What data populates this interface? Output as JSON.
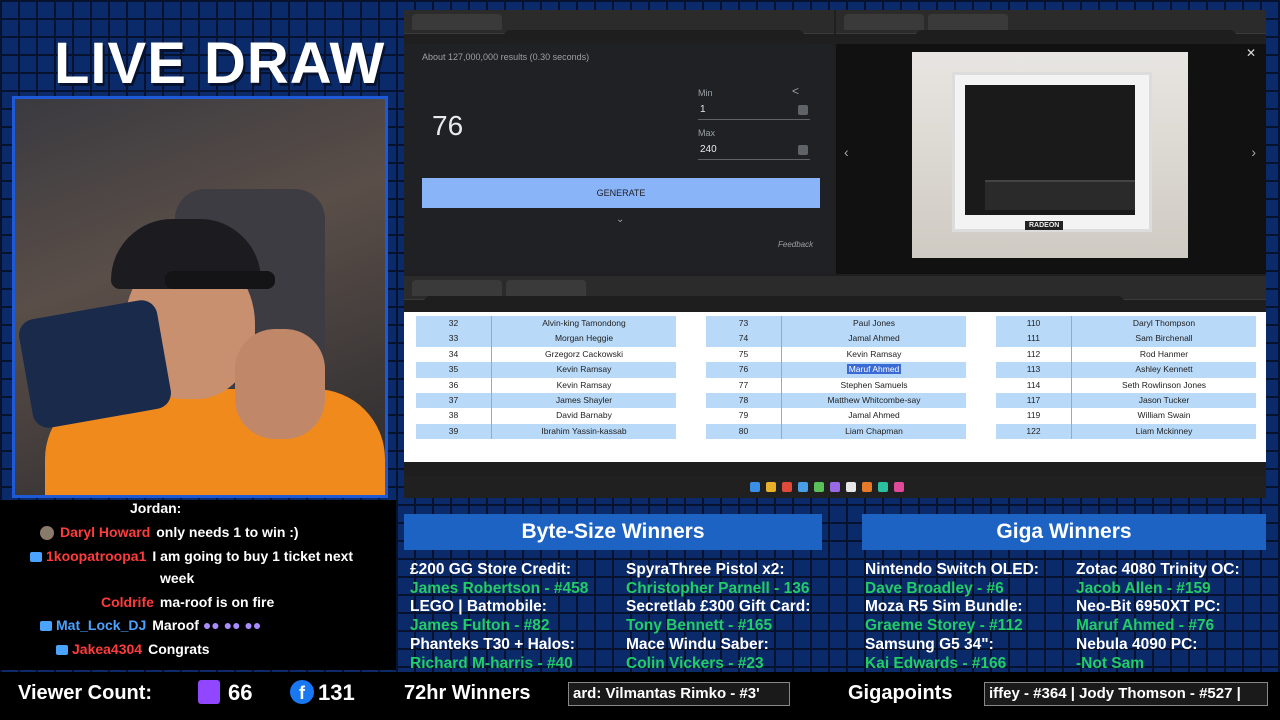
{
  "overlay": {
    "title": "LIVE DRAW"
  },
  "rng": {
    "results_text": "About 127,000,000 results (0.30 seconds)",
    "number": "76",
    "min_label": "Min",
    "min_value": "1",
    "max_label": "Max",
    "max_value": "240",
    "generate_label": "GENERATE",
    "feedback_label": "Feedback"
  },
  "viewer": {
    "gpu_brand": "RADEON"
  },
  "entries": {
    "col1": [
      {
        "n": "32",
        "name": "Alvin-king Tamondong"
      },
      {
        "n": "33",
        "name": "Morgan Heggie"
      },
      {
        "n": "34",
        "name": "Grzegorz Cackowski"
      },
      {
        "n": "35",
        "name": "Kevin Ramsay"
      },
      {
        "n": "36",
        "name": "Kevin Ramsay"
      },
      {
        "n": "37",
        "name": "James Shayler"
      },
      {
        "n": "38",
        "name": "David Barnaby"
      },
      {
        "n": "39",
        "name": "Ibrahim Yassin-kassab"
      }
    ],
    "col2": [
      {
        "n": "73",
        "name": "Paul Jones"
      },
      {
        "n": "74",
        "name": "Jamal Ahmed"
      },
      {
        "n": "75",
        "name": "Kevin Ramsay"
      },
      {
        "n": "76",
        "name": "Maruf Ahmed"
      },
      {
        "n": "77",
        "name": "Stephen Samuels"
      },
      {
        "n": "78",
        "name": "Matthew Whitcombe-say"
      },
      {
        "n": "79",
        "name": "Jamal Ahmed"
      },
      {
        "n": "80",
        "name": "Liam Chapman"
      }
    ],
    "col3": [
      {
        "n": "110",
        "name": "Daryl Thompson"
      },
      {
        "n": "111",
        "name": "Sam Birchenall"
      },
      {
        "n": "112",
        "name": "Rod Hanmer"
      },
      {
        "n": "113",
        "name": "Ashley Kennett"
      },
      {
        "n": "114",
        "name": "Seth Rowlinson Jones"
      },
      {
        "n": "117",
        "name": "Jason Tucker"
      },
      {
        "n": "119",
        "name": "William Swain"
      },
      {
        "n": "122",
        "name": "Liam Mckinney"
      }
    ]
  },
  "chat": {
    "partial": "Jordan:",
    "messages": [
      {
        "user": "Daryl Howard",
        "color": "#ff3b3b",
        "text": "only needs 1 to win :)"
      },
      {
        "user": "1koopatroopa1",
        "color": "#ff3b3b",
        "text": "I am going to buy 1 ticket next",
        "text2": "week"
      },
      {
        "user": "Coldrife",
        "color": "#ff3b3b",
        "text": "ma-roof is on fire"
      },
      {
        "user": "Mat_Lock_DJ",
        "color": "#4aa3ff",
        "text": "Maroof"
      },
      {
        "user": "Jakea4304",
        "color": "#ff3b3b",
        "text": "Congrats"
      }
    ]
  },
  "byte_size": {
    "heading": "Byte-Size Winners",
    "left": [
      {
        "prize": "£200 GG Store Credit:",
        "winner": "James Robertson - #458"
      },
      {
        "prize": "LEGO | Batmobile:",
        "winner": "James Fulton - #82"
      },
      {
        "prize": "Phanteks T30 + Halos:",
        "winner": "Richard M-harris - #40"
      }
    ],
    "right": [
      {
        "prize": "SpyraThree Pistol x2:",
        "winner": "Christopher Parnell - 136"
      },
      {
        "prize": "Secretlab £300 Gift Card:",
        "winner": "Tony Bennett - #165"
      },
      {
        "prize": "Mace Windu Saber:",
        "winner": "Colin Vickers - #23"
      }
    ]
  },
  "giga": {
    "heading": "Giga Winners",
    "left": [
      {
        "prize": "Nintendo Switch OLED:",
        "winner": "Dave Broadley - #6"
      },
      {
        "prize": "Moza R5 Sim Bundle:",
        "winner": "Graeme Storey - #112"
      },
      {
        "prize": "Samsung G5 34\":",
        "winner": "Kai Edwards - #166"
      }
    ],
    "right": [
      {
        "prize": "Zotac 4080 Trinity OC:",
        "winner": "Jacob Allen - #159"
      },
      {
        "prize": "Neo-Bit 6950XT PC:",
        "winner": "Maruf Ahmed - #76"
      },
      {
        "prize": "Nebula 4090 PC:",
        "winner": "-Not Sam"
      }
    ]
  },
  "bottom": {
    "viewer_label": "Viewer Count:",
    "twitch_count": "66",
    "facebook_count": "131",
    "winners72_label": "72hr Winners",
    "winners72_ticker": "ard: Vilmantas Rimko - #3'",
    "gigapoints_label": "Gigapoints",
    "gigapoints_ticker": "iffey - #364 | Jody Thomson - #527 |"
  }
}
